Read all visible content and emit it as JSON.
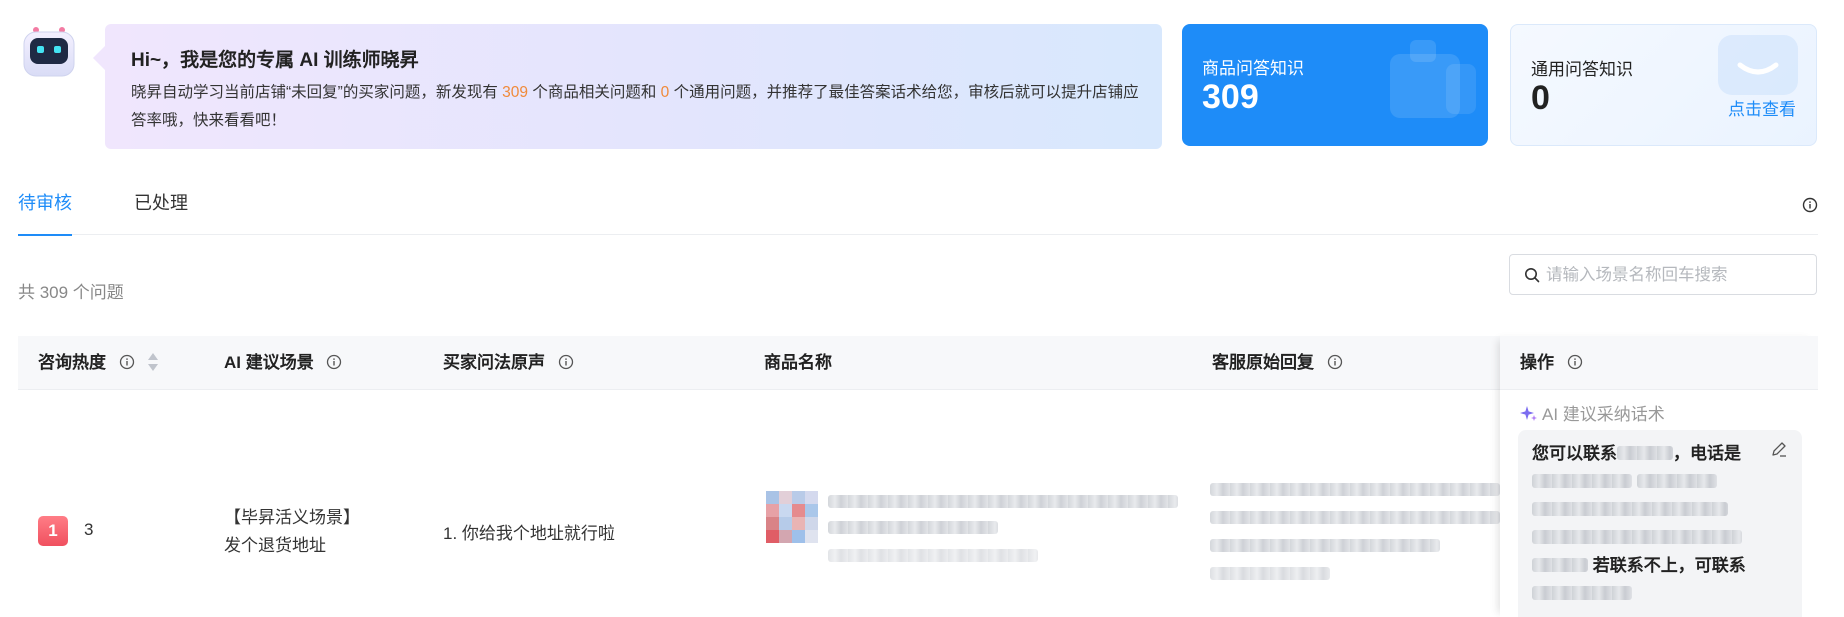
{
  "assistant": {
    "greeting": "Hi~，我是您的专属 AI 训练师晓昇",
    "message_prefix": "晓昇自动学习当前店铺“未回复”的买家问题，新发现有 ",
    "product_count": "309",
    "message_middle": " 个商品相关问题和 ",
    "general_count": "0",
    "message_suffix": " 个通用问题，并推荐了最佳答案话术给您，审核后就可以提升店铺应答率哦，快来看看吧！"
  },
  "cards": {
    "product": {
      "label": "商品问答知识",
      "value": "309"
    },
    "general": {
      "label": "通用问答知识",
      "value": "0",
      "link": "点击查看"
    }
  },
  "tabs": [
    {
      "label": "待审核",
      "active": true
    },
    {
      "label": "已处理",
      "active": false
    }
  ],
  "summary": {
    "count_text": "共 309 个问题"
  },
  "search": {
    "placeholder": "请输入场景名称回车搜索",
    "value": ""
  },
  "table": {
    "columns": {
      "heat": "咨询热度",
      "scene": "AI 建议场景",
      "question": "买家问法原声",
      "product": "商品名称",
      "reply": "客服原始回复",
      "action": "操作"
    },
    "rows": [
      {
        "rank": "1",
        "heat": "3",
        "scene_line1": "【毕昇活义场景】",
        "scene_line2": "发个退货地址",
        "question": "1. 你给我个地址就行啦",
        "ai_label": "AI 建议采纳话术",
        "suggest_part1": "您可以联系",
        "suggest_part2": "，电话是",
        "suggest_part3": "若联系不上，可联系"
      }
    ]
  },
  "colors": {
    "accent": "#1e8cf8",
    "highlight": "#f08a3a",
    "rank": "#f0505f"
  }
}
